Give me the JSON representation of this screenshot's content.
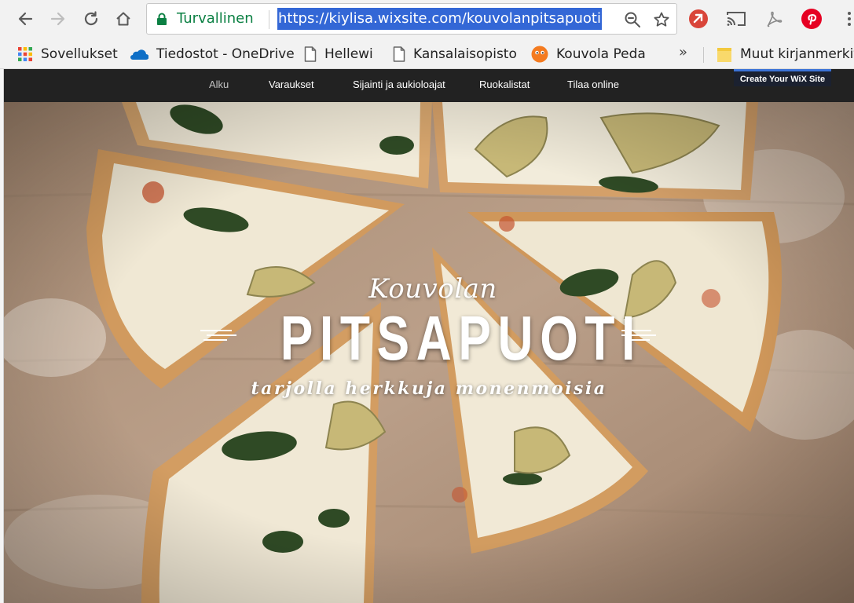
{
  "browser": {
    "omnibox": {
      "secure_label": "Turvallinen",
      "url": "https://kiylisa.wixsite.com/kouvolanpitsapuoti"
    },
    "nav_icons": [
      "back-icon",
      "forward-icon",
      "reload-icon",
      "home-icon"
    ],
    "omnibox_icons": [
      "lock-icon",
      "zoom-icon",
      "star-icon"
    ],
    "extension_icons": [
      "extension-icon",
      "cast-icon",
      "pdf-icon",
      "pinterest-icon"
    ],
    "colors": {
      "secure": "#0b8043",
      "url_selection": "#3367d6",
      "pinterest": "#e60023"
    }
  },
  "bookmarks": {
    "items": [
      {
        "label": "Sovellukset",
        "icon": "apps-grid-icon"
      },
      {
        "label": "Tiedostot - OneDrive",
        "icon": "onedrive-icon"
      },
      {
        "label": "Hellewi",
        "icon": "page-icon"
      },
      {
        "label": "Kansalaisopisto",
        "icon": "page-icon"
      },
      {
        "label": "Kouvola Peda",
        "icon": "orange-face-icon"
      }
    ],
    "overflow": "»",
    "other_folder": "Muut kirjanmerkit"
  },
  "site": {
    "nav": [
      "Alku",
      "Varaukset",
      "Sijainti ja aukioloajat",
      "Ruokalistat",
      "Tilaa online"
    ],
    "active_nav": "Alku",
    "wix_badge": "Create Your WiX Site",
    "hero": {
      "script": "Kouvolan",
      "title": "PITSAPUOTI",
      "tagline": "tarjolla herkkuja monenmoisia"
    },
    "colors": {
      "nav_bg": "#222222",
      "badge_bg": "#1b2130",
      "board": "#b59a83"
    }
  }
}
